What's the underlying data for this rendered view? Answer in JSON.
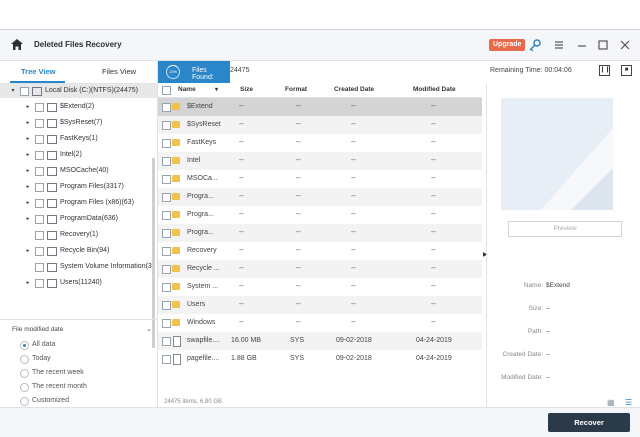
{
  "app": {
    "title": "Deleted Files Recovery",
    "upgrade_label": "Upgrade"
  },
  "tabs": [
    {
      "label": "Tree View"
    },
    {
      "label": "Files View"
    }
  ],
  "tree": [
    {
      "label": "Local Disk (C:)(NTFS)(24475)",
      "level": 0,
      "expanded": true,
      "selected": true,
      "has_arrow": true
    },
    {
      "label": "$Extend(2)",
      "level": 1,
      "has_arrow": true
    },
    {
      "label": "$SysReset(7)",
      "level": 1,
      "has_arrow": true
    },
    {
      "label": "FastKeys(1)",
      "level": 1,
      "has_arrow": true
    },
    {
      "label": "Intel(2)",
      "level": 1,
      "has_arrow": true
    },
    {
      "label": "MSOCache(40)",
      "level": 1,
      "has_arrow": true
    },
    {
      "label": "Program Files(3317)",
      "level": 1,
      "has_arrow": true
    },
    {
      "label": "Program Files (x86)(63)",
      "level": 1,
      "has_arrow": true
    },
    {
      "label": "ProgramData(636)",
      "level": 1,
      "has_arrow": true
    },
    {
      "label": "Recovery(1)",
      "level": 1,
      "has_arrow": false
    },
    {
      "label": "Recycle Bin(94)",
      "level": 1,
      "has_arrow": true
    },
    {
      "label": "System Volume Information(3",
      "level": 1,
      "has_arrow": false
    },
    {
      "label": "Users(11240)",
      "level": 1,
      "has_arrow": true
    }
  ],
  "filter": {
    "title": "File modified date",
    "options": [
      {
        "label": "All data",
        "selected": true
      },
      {
        "label": "Today",
        "selected": false
      },
      {
        "label": "The recent week",
        "selected": false
      },
      {
        "label": "The recent month",
        "selected": false
      },
      {
        "label": "Customized",
        "selected": false
      }
    ]
  },
  "status": {
    "spinner_text": "13%",
    "files_found_label": "Files Found:",
    "files_found_count": "24475",
    "remaining_time": "Remaining Time: 00:04:06"
  },
  "table": {
    "headers": {
      "name": "Name",
      "size": "Size",
      "format": "Format",
      "created": "Created Date",
      "modified": "Modified Date"
    },
    "rows": [
      {
        "name": "$Extend",
        "size": "--",
        "format": "--",
        "created": "--",
        "modified": "--",
        "icon": "folder",
        "selected": true
      },
      {
        "name": "$SysReset",
        "size": "--",
        "format": "--",
        "created": "--",
        "modified": "--",
        "icon": "folder"
      },
      {
        "name": "FastKeys",
        "size": "--",
        "format": "--",
        "created": "--",
        "modified": "--",
        "icon": "folder"
      },
      {
        "name": "Intel",
        "size": "--",
        "format": "--",
        "created": "--",
        "modified": "--",
        "icon": "folder"
      },
      {
        "name": "MSOCa...",
        "size": "--",
        "format": "--",
        "created": "--",
        "modified": "--",
        "icon": "folder"
      },
      {
        "name": "Progra...",
        "size": "--",
        "format": "--",
        "created": "--",
        "modified": "--",
        "icon": "folder"
      },
      {
        "name": "Progra...",
        "size": "--",
        "format": "--",
        "created": "--",
        "modified": "--",
        "icon": "folder"
      },
      {
        "name": "Progra...",
        "size": "--",
        "format": "--",
        "created": "--",
        "modified": "--",
        "icon": "folder"
      },
      {
        "name": "Recovery",
        "size": "--",
        "format": "--",
        "created": "--",
        "modified": "--",
        "icon": "folder"
      },
      {
        "name": "Recycle ...",
        "size": "--",
        "format": "--",
        "created": "--",
        "modified": "--",
        "icon": "folder"
      },
      {
        "name": "System ...",
        "size": "--",
        "format": "--",
        "created": "--",
        "modified": "--",
        "icon": "folder"
      },
      {
        "name": "Users",
        "size": "--",
        "format": "--",
        "created": "--",
        "modified": "--",
        "icon": "folder"
      },
      {
        "name": "Windows",
        "size": "--",
        "format": "--",
        "created": "--",
        "modified": "--",
        "icon": "folder"
      },
      {
        "name": "swapfile....",
        "size": "16.00 MB",
        "format": "SYS",
        "created": "09-02-2018",
        "modified": "04-24-2019",
        "icon": "file"
      },
      {
        "name": "pagefile....",
        "size": "1.88 GB",
        "format": "SYS",
        "created": "09-02-2018",
        "modified": "04-24-2019",
        "icon": "file"
      }
    ],
    "footer": "24475 items, 6.80 GB"
  },
  "preview": {
    "button_label": "Preview",
    "fields": [
      {
        "label": "Name:",
        "value": "$Extend"
      },
      {
        "label": "Size:",
        "value": "--"
      },
      {
        "label": "Path:",
        "value": "--"
      },
      {
        "label": "Created Date:",
        "value": "--"
      },
      {
        "label": "Modified Date:",
        "value": "--"
      }
    ]
  },
  "actions": {
    "recover_label": "Recover"
  },
  "colors": {
    "accent": "#2a86c8",
    "upgrade": "#e86a4a",
    "recover_bg": "#2b3a48"
  }
}
